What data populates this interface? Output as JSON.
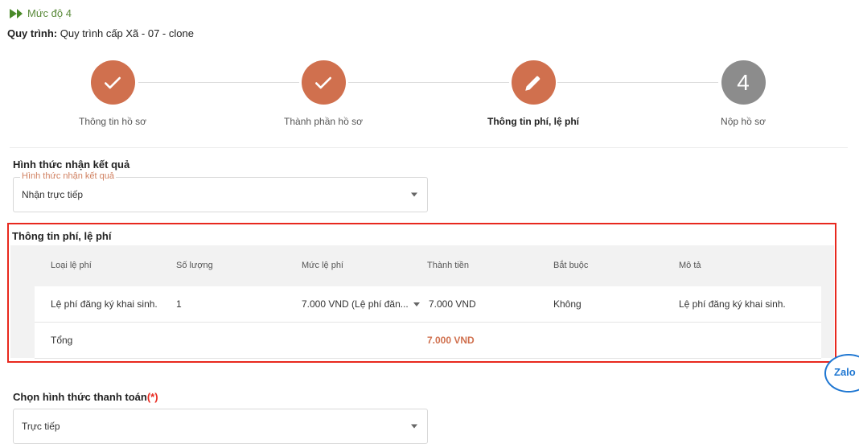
{
  "header": {
    "level_label": "Mức độ 4",
    "process_label": "Quy trình:",
    "process_value": "Quy trình cấp Xã - 07 - clone"
  },
  "stepper": {
    "steps": [
      {
        "label": "Thông tin hồ sơ",
        "state": "done",
        "icon": "check-icon",
        "number": ""
      },
      {
        "label": "Thành phần hồ sơ",
        "state": "done",
        "icon": "check-icon",
        "number": ""
      },
      {
        "label": "Thông tin phí, lệ phí",
        "state": "active",
        "icon": "pencil-icon",
        "number": ""
      },
      {
        "label": "Nộp hồ sơ",
        "state": "todo",
        "icon": "",
        "number": "4"
      }
    ]
  },
  "result_method": {
    "section_title": "Hình thức nhận kết quả",
    "field_label": "Hình thức nhận kết quả",
    "value": "Nhận trực tiếp"
  },
  "fees": {
    "section_title": "Thông tin phí, lệ phí",
    "columns": [
      "Loại lệ phí",
      "Số lượng",
      "Mức lệ phí",
      "Thành tiền",
      "Bắt buộc",
      "Mô tả"
    ],
    "rows": [
      {
        "fee_type": "Lệ phí đăng ký khai sinh.",
        "quantity": "1",
        "fee_level": "7.000 VND (Lệ phí đăn...",
        "amount": "7.000 VND",
        "required": "Không",
        "description": "Lệ phí đăng ký khai sinh."
      }
    ],
    "total_label": "Tổng",
    "total_value": "7.000 VND"
  },
  "payment": {
    "section_title": "Chọn hình thức thanh toán",
    "required_mark": "(*)",
    "value": "Trực tiếp"
  },
  "zalo": {
    "label": "Zalo"
  },
  "colors": {
    "accent": "#d0704e",
    "inactive_step": "#8c8c8c",
    "highlight_border": "#e8281e",
    "brand_green": "#4a8a2a",
    "zalo_blue": "#1f77d2"
  }
}
